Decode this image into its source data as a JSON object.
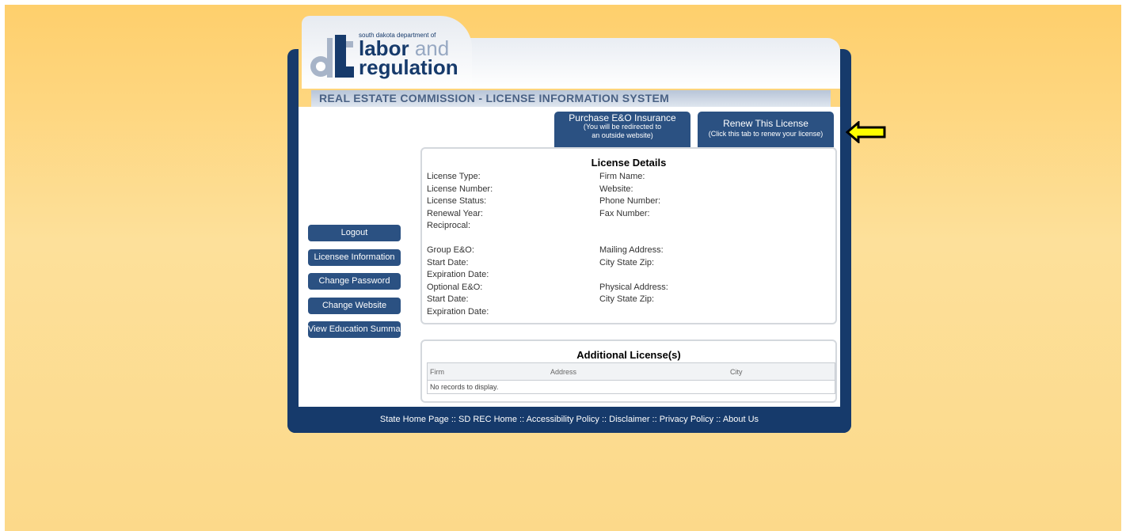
{
  "logo": {
    "small_text": "south dakota department of",
    "line1_word": "labor",
    "line1_and": "and",
    "line2": "regulation",
    "lettermark": "dLR"
  },
  "title_bar": "REAL ESTATE COMMISSION - LICENSE INFORMATION SYSTEM",
  "top_buttons": {
    "eo": {
      "line1": "Purchase E&O Insurance",
      "line2": "(You will be redirected to",
      "line3": "an outside website)"
    },
    "renew": {
      "line1": "Renew This License",
      "line2": "(Click this tab to renew your license)"
    }
  },
  "sidebar": {
    "items": [
      {
        "label": "Logout"
      },
      {
        "label": "Licensee Information"
      },
      {
        "label": "Change Password"
      },
      {
        "label": "Change Website"
      },
      {
        "label": "View Education Summary"
      }
    ]
  },
  "details": {
    "title": "License Details",
    "left_fields": [
      "License Type:",
      "License Number:",
      "License Status:",
      "Renewal Year:",
      "Reciprocal:",
      "",
      "Group E&O:",
      "Start Date:",
      "Expiration Date:",
      "Optional E&O:",
      "Start Date:",
      "Expiration Date:"
    ],
    "right_fields": [
      "Firm Name:",
      "Website:",
      "Phone Number:",
      "Fax Number:",
      "",
      "",
      "Mailing Address:",
      "City State Zip:",
      "",
      "Physical Address:",
      "City State Zip:"
    ]
  },
  "additional": {
    "title": "Additional License(s)",
    "columns": [
      "Firm",
      "Address",
      "City"
    ],
    "empty_text": "No records to display."
  },
  "footer": {
    "links": [
      "State Home Page",
      "SD REC Home",
      "Accessibility Policy",
      "Disclaimer",
      "Privacy Policy",
      "About Us"
    ],
    "separator": " :: "
  },
  "colors": {
    "navy": "#163a6b",
    "button_blue": "#2b5182",
    "background": "#fecf6c",
    "arrow_yellow": "#ffff00"
  },
  "icons": {
    "pointer_arrow": "arrow-left-icon"
  }
}
